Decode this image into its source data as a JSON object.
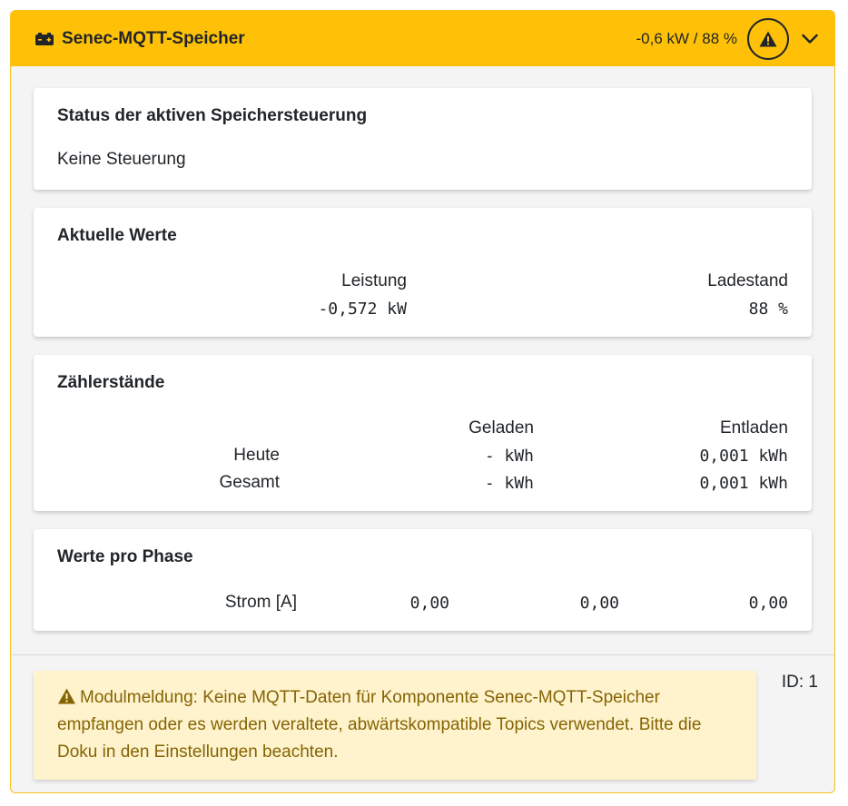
{
  "header": {
    "title": "Senec-MQTT-Speicher",
    "summary": "-0,6 kW / 88 %",
    "icon": "battery-icon",
    "warning_icon": "warning-icon",
    "expand_icon": "chevron-down-icon",
    "accent_color": "#ffc107"
  },
  "status_panel": {
    "title": "Status der aktiven Speichersteuerung",
    "value": "Keine Steuerung"
  },
  "current_values": {
    "title": "Aktuelle Werte",
    "power_label": "Leistung",
    "power_value": "-0,572 kW",
    "soc_label": "Ladestand",
    "soc_value": "88 %"
  },
  "counters": {
    "title": "Zählerstände",
    "col_charged": "Geladen",
    "col_discharged": "Entladen",
    "rows": [
      {
        "label": "Heute",
        "charged": "- kWh",
        "discharged": "0,001 kWh"
      },
      {
        "label": "Gesamt",
        "charged": "- kWh",
        "discharged": "0,001 kWh"
      }
    ]
  },
  "phases": {
    "title": "Werte pro Phase",
    "label": "Strom [A]",
    "values": [
      "0,00",
      "0,00",
      "0,00"
    ]
  },
  "footer": {
    "alert_text": "Modulmeldung: Keine MQTT-Daten für Komponente Senec-MQTT-Speicher empfangen oder es werden veraltete, abwärtskompatible Topics verwendet. Bitte die Doku in den Einstellungen beachten.",
    "id_label": "ID: 1",
    "alert_icon": "warning-icon"
  }
}
